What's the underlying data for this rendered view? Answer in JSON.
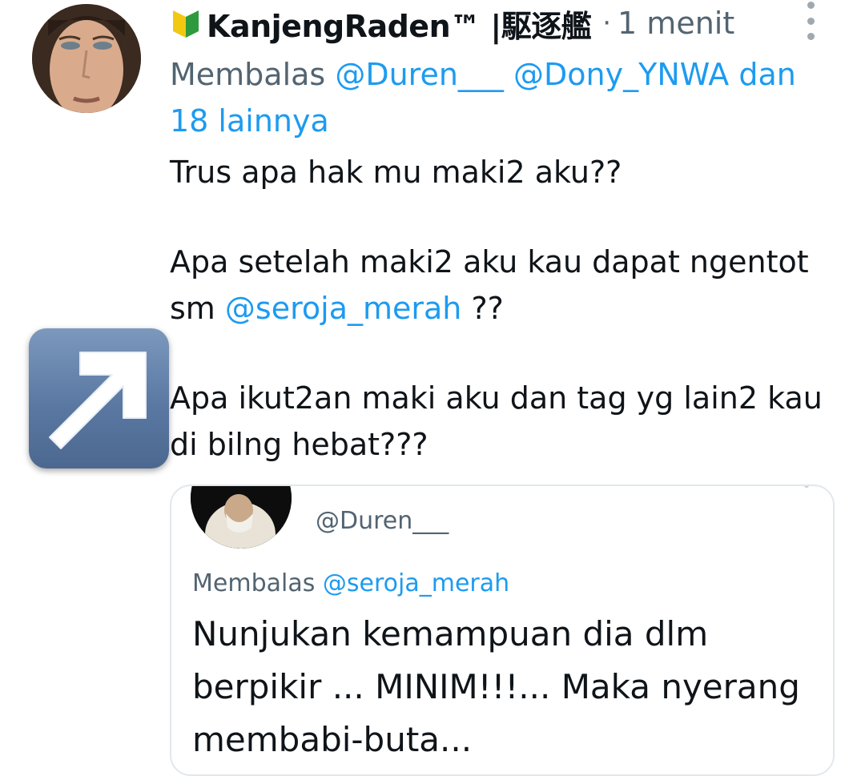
{
  "tweet": {
    "author_name": "KanjengRaden™ |駆逐艦",
    "timestamp": "1 menit",
    "reply_prefix": "Membalas",
    "reply_mentions": [
      "@Duren___",
      "@Dony_YNWA"
    ],
    "reply_and": "dan",
    "reply_others": "18 lainnya",
    "body_line1": "Trus apa hak mu maki2 aku??",
    "body_line2": "Apa setelah maki2 aku kau dapat ngentot sm",
    "body_line2_mention": "@seroja_merah",
    "body_line2_suffix": "??",
    "body_line3": "Apa ikut2an maki aku dan tag yg lain2 kau di bilng hebat???"
  },
  "quoted": {
    "handle": "@Duren___",
    "reply_prefix": "Membalas",
    "reply_mention": "@seroja_merah",
    "text": "Nunjukan kemampuan dia dlm berpikir ... MINIM!!!... Maka nyerang membabi-buta..."
  },
  "colors": {
    "accent": "#1d9bf0",
    "secondary_text": "#536471",
    "primary_text": "#0f1419"
  },
  "icons": {
    "badge": "beginner-badge-icon",
    "more": "more-options-icon",
    "overlay": "arrow-up-right-icon"
  }
}
